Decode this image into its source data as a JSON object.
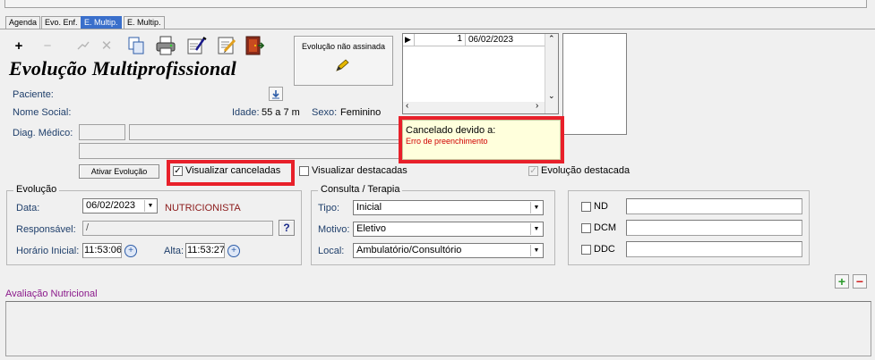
{
  "tabs": [
    {
      "label": "Agenda",
      "active": false
    },
    {
      "label": "Evo. Enf.",
      "active": false
    },
    {
      "label": "E. Multip.",
      "active": true
    },
    {
      "label": "E. Multip.",
      "active": false
    }
  ],
  "toolbar": {
    "icons": [
      "add-icon",
      "remove-icon",
      "edit-icon",
      "cancel-icon",
      "copy-icon",
      "print-icon",
      "sign-icon",
      "notes-icon",
      "exit-door-icon"
    ]
  },
  "page_title": "Evolução Multiprofissional",
  "signature": {
    "status": "Evolução não assinada",
    "icon": "pen-icon"
  },
  "grid": {
    "row_number": "1",
    "row_date": "06/02/2023"
  },
  "patient": {
    "paciente_label": "Paciente:",
    "nome_social_label": "Nome Social:",
    "idade_label": "Idade:",
    "idade_value": "55 a 7 m",
    "sexo_label": "Sexo:",
    "sexo_value": "Feminino",
    "diag_label": "Diag. Médico:"
  },
  "cancel_note": {
    "title": "Cancelado devido a:",
    "reason": "Erro de preenchimento"
  },
  "actions": {
    "ativar_label": "Ativar Evolução",
    "visualizar_canceladas": {
      "label": "Visualizar canceladas",
      "checked": true
    },
    "visualizar_destacadas": {
      "label": "Visualizar destacadas",
      "checked": false
    },
    "evolucao_destacada": {
      "label": "Evolução destacada",
      "checked": true
    }
  },
  "evolucao": {
    "group_title": "Evolução",
    "data_label": "Data:",
    "data_value": "06/02/2023",
    "profissao": "NUTRICIONISTA",
    "responsavel_label": "Responsável:",
    "responsavel_value": "/",
    "help_label": "?",
    "horario_inicial_label": "Horário Inicial:",
    "horario_inicial_value": "11:53:06",
    "alta_label": "Alta:",
    "alta_value": "11:53:27"
  },
  "consulta": {
    "group_title": "Consulta / Terapia",
    "tipo_label": "Tipo:",
    "tipo_value": "Inicial",
    "motivo_label": "Motivo:",
    "motivo_value": "Eletivo",
    "local_label": "Local:",
    "local_value": "Ambulatório/Consultório"
  },
  "scores": [
    {
      "label": "ND",
      "checked": false
    },
    {
      "label": "DCM",
      "checked": false
    },
    {
      "label": "DDC",
      "checked": false
    }
  ],
  "avaliacao": {
    "title": "Avaliação Nutricional",
    "add_label": "+",
    "remove_label": "−"
  },
  "colors": {
    "tab_active": "#3a6fcb",
    "highlight_red": "#e8202a",
    "note_bg": "#ffffdc",
    "profession_text": "#8b1a1a",
    "section_title": "#8b1a8b"
  }
}
